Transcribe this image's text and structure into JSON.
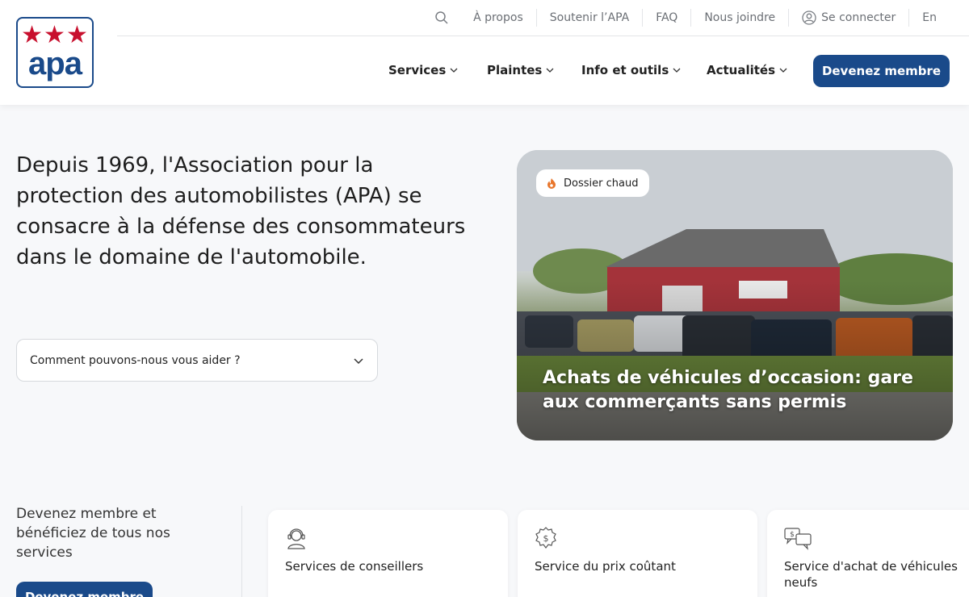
{
  "brand": {
    "logo_text": "apa",
    "logo_stars": "★★★",
    "accent": "#1a4a8a",
    "star_color": "#c8102e"
  },
  "topbar": {
    "items": [
      "À propos",
      "Soutenir l’APA",
      "FAQ",
      "Nous joindre",
      "Se connecter",
      "En"
    ]
  },
  "nav": {
    "items": [
      "Services",
      "Plaintes",
      "Info et outils",
      "Actualités"
    ],
    "cta": "Devenez membre"
  },
  "hero": {
    "text": "Depuis 1969, l'Association pour la protection des automobilistes (APA) se consacre à la défense des consommateurs dans le domaine de l'automobile.",
    "help_select": "Comment pouvons-nous vous aider ?"
  },
  "feature": {
    "badge": "Dossier chaud",
    "title": "Achats de véhicules d’occasion: gare aux commerçants sans permis"
  },
  "member": {
    "text": "Devenez membre et bénéficiez de tous nos services",
    "cta": "Devenez membre"
  },
  "services": [
    {
      "label": "Services de conseillers",
      "icon": "advisor-icon"
    },
    {
      "label": "Service du prix coûtant",
      "icon": "price-tag-icon"
    },
    {
      "label": "Service d'achat de véhicules neufs",
      "icon": "chat-money-icon"
    }
  ]
}
